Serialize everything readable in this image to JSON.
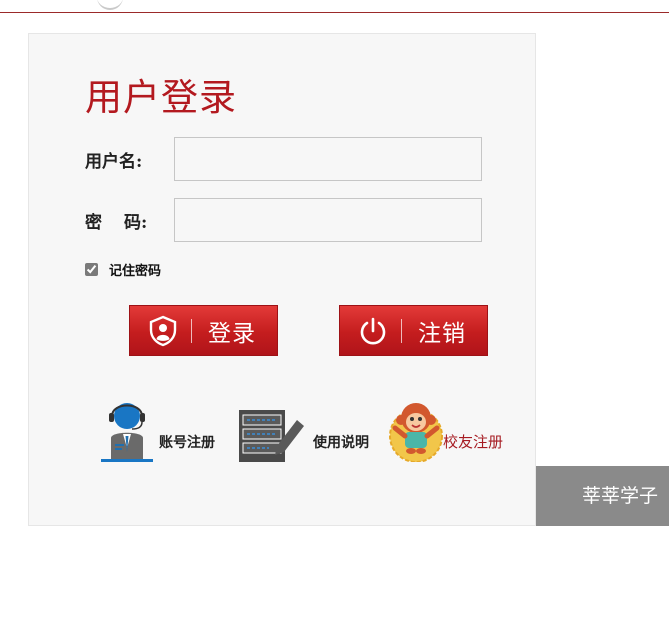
{
  "login": {
    "title": "用户登录",
    "username_label": "用户名:",
    "password_label_1": "密",
    "password_label_2": "码:",
    "username_value": "",
    "password_value": "",
    "remember_label": "记住密码",
    "remember_checked": true,
    "login_button": "登录",
    "logout_button": "注销"
  },
  "links": {
    "register": "账号注册",
    "manual": "使用说明",
    "alumni": "校友注册"
  },
  "side_banner": {
    "text": "莘莘学子"
  },
  "colors": {
    "accent": "#b3191f",
    "panel_bg": "#f7f7f7",
    "banner_bg": "#8a8a8a"
  },
  "icons": {
    "login": "shield-user-icon",
    "logout": "power-icon",
    "register": "support-agent-icon",
    "manual": "document-edit-icon",
    "alumni": "monkey-mascot-icon"
  }
}
